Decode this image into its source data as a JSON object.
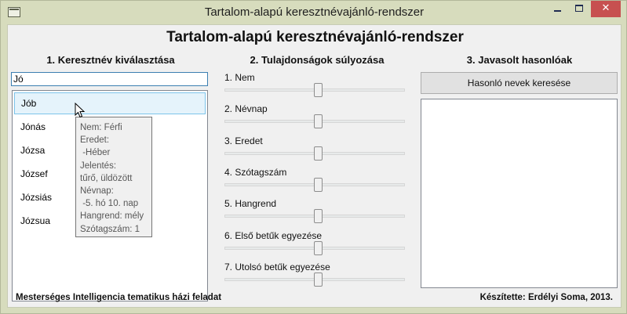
{
  "window": {
    "title": "Tartalom-alapú keresztnévajánló-rendszer"
  },
  "main": {
    "title": "Tartalom-alapú keresztnévajánló-rendszer"
  },
  "section1": {
    "heading": "1. Keresztnév kiválasztása",
    "input_value": "Jó",
    "names": [
      "Jób",
      "Jónás",
      "Józsa",
      "József",
      "Józsiás",
      "Józsua"
    ],
    "selected_name": "Jób"
  },
  "tooltip": {
    "lines": [
      "Nem: Férfi",
      "Eredet:",
      " -Héber",
      "Jelentés:",
      "tűrő, üldözött",
      "Névnap:",
      " -5. hó 10. nap",
      "Hangrend: mély",
      "Szótagszám: 1"
    ]
  },
  "section2": {
    "heading": "2. Tulajdonságok súlyozása",
    "sliders": [
      {
        "label": "1. Nem",
        "level": 0.5
      },
      {
        "label": "2. Névnap",
        "level": 0.5
      },
      {
        "label": "3. Eredet",
        "level": 0.5
      },
      {
        "label": "4. Szótagszám",
        "level": 0.5
      },
      {
        "label": "5. Hangrend",
        "level": 0.5
      },
      {
        "label": "6. Első betűk egyezése",
        "level": 0.5
      },
      {
        "label": "7. Utolsó betűk egyezése",
        "level": 0.5
      }
    ]
  },
  "section3": {
    "heading": "3. Javasolt hasonlóak",
    "search_button": "Hasonló nevek keresése"
  },
  "footer": {
    "left": "Mesterséges Intelligencia tematikus házi feladat",
    "right": "Készítette: Erdélyi Soma, 2013."
  }
}
